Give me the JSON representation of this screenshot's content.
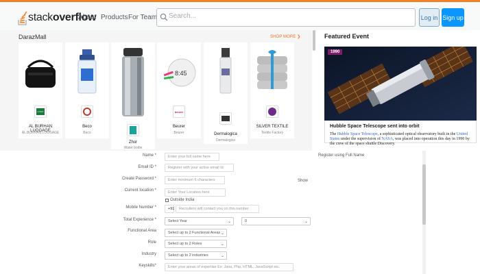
{
  "topbar": {
    "logo_stack": "stack",
    "logo_overflow": "overflow",
    "nav": [
      "About",
      "Products",
      "For Teams"
    ],
    "search_placeholder": "Search...",
    "login_label": "Log in",
    "signup_label": "Sign up",
    "accent": "#f48024"
  },
  "mall": {
    "title": "DarazMall",
    "shop_more": "SHOP MORE ❯",
    "accent": "#f57224",
    "products": [
      {
        "name": "AL BURHAN LUGGAGE",
        "sub": "AL BURHAN LUGGAGE",
        "icon": "bag-icon"
      },
      {
        "name": "Beco",
        "sub": "Beco",
        "icon": "bottle-icon"
      },
      {
        "name": "Zhor",
        "sub": "Water bottle",
        "icon": "flask-icon"
      },
      {
        "name": "Beurer",
        "sub": "Beurer",
        "icon": "scale-icon"
      },
      {
        "name": "Dermalogica",
        "sub": "Dermalogica",
        "icon": "serum-icon"
      },
      {
        "name": "SILVER TEXTILE",
        "sub": "Textile Factory",
        "icon": "towel-icon"
      }
    ]
  },
  "featured": {
    "title": "Featured Event",
    "year": "1990",
    "headline": "Hubble Space Telescope sent into orbit",
    "body_pre": "The ",
    "body_link1": "Hubble Space Telescope",
    "body_mid1": ", a sophisticated optical observatory built in the ",
    "body_link2": "United States",
    "body_mid2": " under the supervision of ",
    "body_link3": "NASA",
    "body_post": ", was placed into operation this day in 1990 by the crew of the space shuttle Discovery."
  },
  "form": {
    "name_label": "Name *",
    "name_placeholder": "Enter your full name here",
    "name_hint": "Register using Full Name",
    "email_label": "Email ID *",
    "email_placeholder": "Register with your active email Id",
    "password_label": "Create Password *",
    "password_placeholder": "Enter minimum 6 characters",
    "password_show": "Show",
    "location_label": "Current location *",
    "location_placeholder": "Enter Your Location here",
    "outside_india": "Outside India",
    "mobile_label": "Mobile Number *",
    "mobile_code": "+91",
    "mobile_placeholder": "Recruiters will contact you on this number",
    "experience_label": "Total Experience *",
    "experience_year": "Select Year",
    "experience_month": "0",
    "functional_label": "Functional Area",
    "functional_value": "Select up to 2 Functional Areas",
    "role_label": "Role",
    "role_value": "Select up to 2 Roles",
    "industry_label": "Industry",
    "industry_value": "Select up to 2 industries",
    "keyskills_label": "Keyskills*",
    "keyskills_placeholder": "Enter your areas of expertise Ex: Java, Php, HTML, JavaScript etc."
  }
}
